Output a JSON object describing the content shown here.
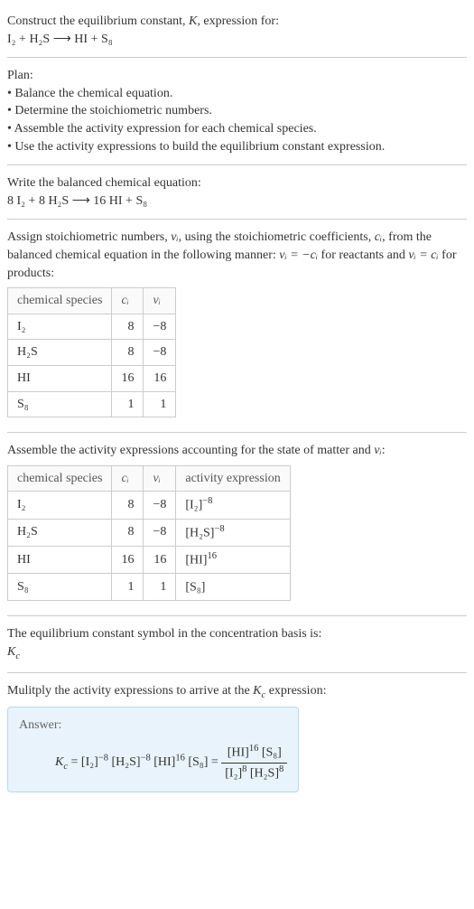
{
  "header": {
    "line1": "Construct the equilibrium constant, ",
    "K": "K",
    "line1b": ", expression for:",
    "equation": "I₂ + H₂S ⟶ HI + S₈"
  },
  "plan": {
    "title": "Plan:",
    "items": [
      "• Balance the chemical equation.",
      "• Determine the stoichiometric numbers.",
      "• Assemble the activity expression for each chemical species.",
      "• Use the activity expressions to build the equilibrium constant expression."
    ]
  },
  "balanced": {
    "intro": "Write the balanced chemical equation:",
    "equation": "8 I₂ + 8 H₂S ⟶ 16 HI + S₈"
  },
  "assign": {
    "intro1": "Assign stoichiometric numbers, ",
    "nu_i": "νᵢ",
    "intro2": ", using the stoichiometric coefficients, ",
    "c_i": "cᵢ",
    "intro3": ", from the balanced chemical equation in the following manner: ",
    "rel1": "νᵢ = −cᵢ",
    "intro4": " for reactants and ",
    "rel2": "νᵢ = cᵢ",
    "intro5": " for products:"
  },
  "table1": {
    "headers": [
      "chemical species",
      "cᵢ",
      "νᵢ"
    ],
    "rows": [
      [
        "I₂",
        "8",
        "−8"
      ],
      [
        "H₂S",
        "8",
        "−8"
      ],
      [
        "HI",
        "16",
        "16"
      ],
      [
        "S₈",
        "1",
        "1"
      ]
    ]
  },
  "assemble": {
    "intro1": "Assemble the activity expressions accounting for the state of matter and ",
    "nu_i": "νᵢ",
    "intro2": ":"
  },
  "table2": {
    "headers": [
      "chemical species",
      "cᵢ",
      "νᵢ",
      "activity expression"
    ],
    "rows": [
      {
        "species": "I₂",
        "c": "8",
        "nu": "−8",
        "expr_base": "[I₂]",
        "expr_sup": "−8"
      },
      {
        "species": "H₂S",
        "c": "8",
        "nu": "−8",
        "expr_base": "[H₂S]",
        "expr_sup": "−8"
      },
      {
        "species": "HI",
        "c": "16",
        "nu": "16",
        "expr_base": "[HI]",
        "expr_sup": "16"
      },
      {
        "species": "S₈",
        "c": "1",
        "nu": "1",
        "expr_base": "[S₈]",
        "expr_sup": ""
      }
    ]
  },
  "symbol": {
    "line1": "The equilibrium constant symbol in the concentration basis is:",
    "Kc": "K",
    "Kc_sub": "c"
  },
  "multiply": {
    "line1a": "Mulitply the activity expressions to arrive at the ",
    "Kc": "K",
    "Kc_sub": "c",
    "line1b": " expression:"
  },
  "answer": {
    "label": "Answer:",
    "Kc": "K",
    "Kc_sub": "c",
    "eq": " = ",
    "t1_base": "[I₂]",
    "t1_sup": "−8",
    "t2_base": "[H₂S]",
    "t2_sup": "−8",
    "t3_base": "[HI]",
    "t3_sup": "16",
    "t4_base": "[S₈]",
    "eq2": " = ",
    "num1_base": "[HI]",
    "num1_sup": "16",
    "num2_base": "[S₈]",
    "den1_base": "[I₂]",
    "den1_sup": "8",
    "den2_base": "[H₂S]",
    "den2_sup": "8"
  },
  "chart_data": {
    "type": "table",
    "stoichiometry_table": {
      "columns": [
        "chemical species",
        "c_i",
        "nu_i"
      ],
      "rows": [
        {
          "chemical species": "I2",
          "c_i": 8,
          "nu_i": -8
        },
        {
          "chemical species": "H2S",
          "c_i": 8,
          "nu_i": -8
        },
        {
          "chemical species": "HI",
          "c_i": 16,
          "nu_i": 16
        },
        {
          "chemical species": "S8",
          "c_i": 1,
          "nu_i": 1
        }
      ]
    },
    "activity_table": {
      "columns": [
        "chemical species",
        "c_i",
        "nu_i",
        "activity expression"
      ],
      "rows": [
        {
          "chemical species": "I2",
          "c_i": 8,
          "nu_i": -8,
          "activity expression": "[I2]^-8"
        },
        {
          "chemical species": "H2S",
          "c_i": 8,
          "nu_i": -8,
          "activity expression": "[H2S]^-8"
        },
        {
          "chemical species": "HI",
          "c_i": 16,
          "nu_i": 16,
          "activity expression": "[HI]^16"
        },
        {
          "chemical species": "S8",
          "c_i": 1,
          "nu_i": 1,
          "activity expression": "[S8]"
        }
      ]
    }
  }
}
